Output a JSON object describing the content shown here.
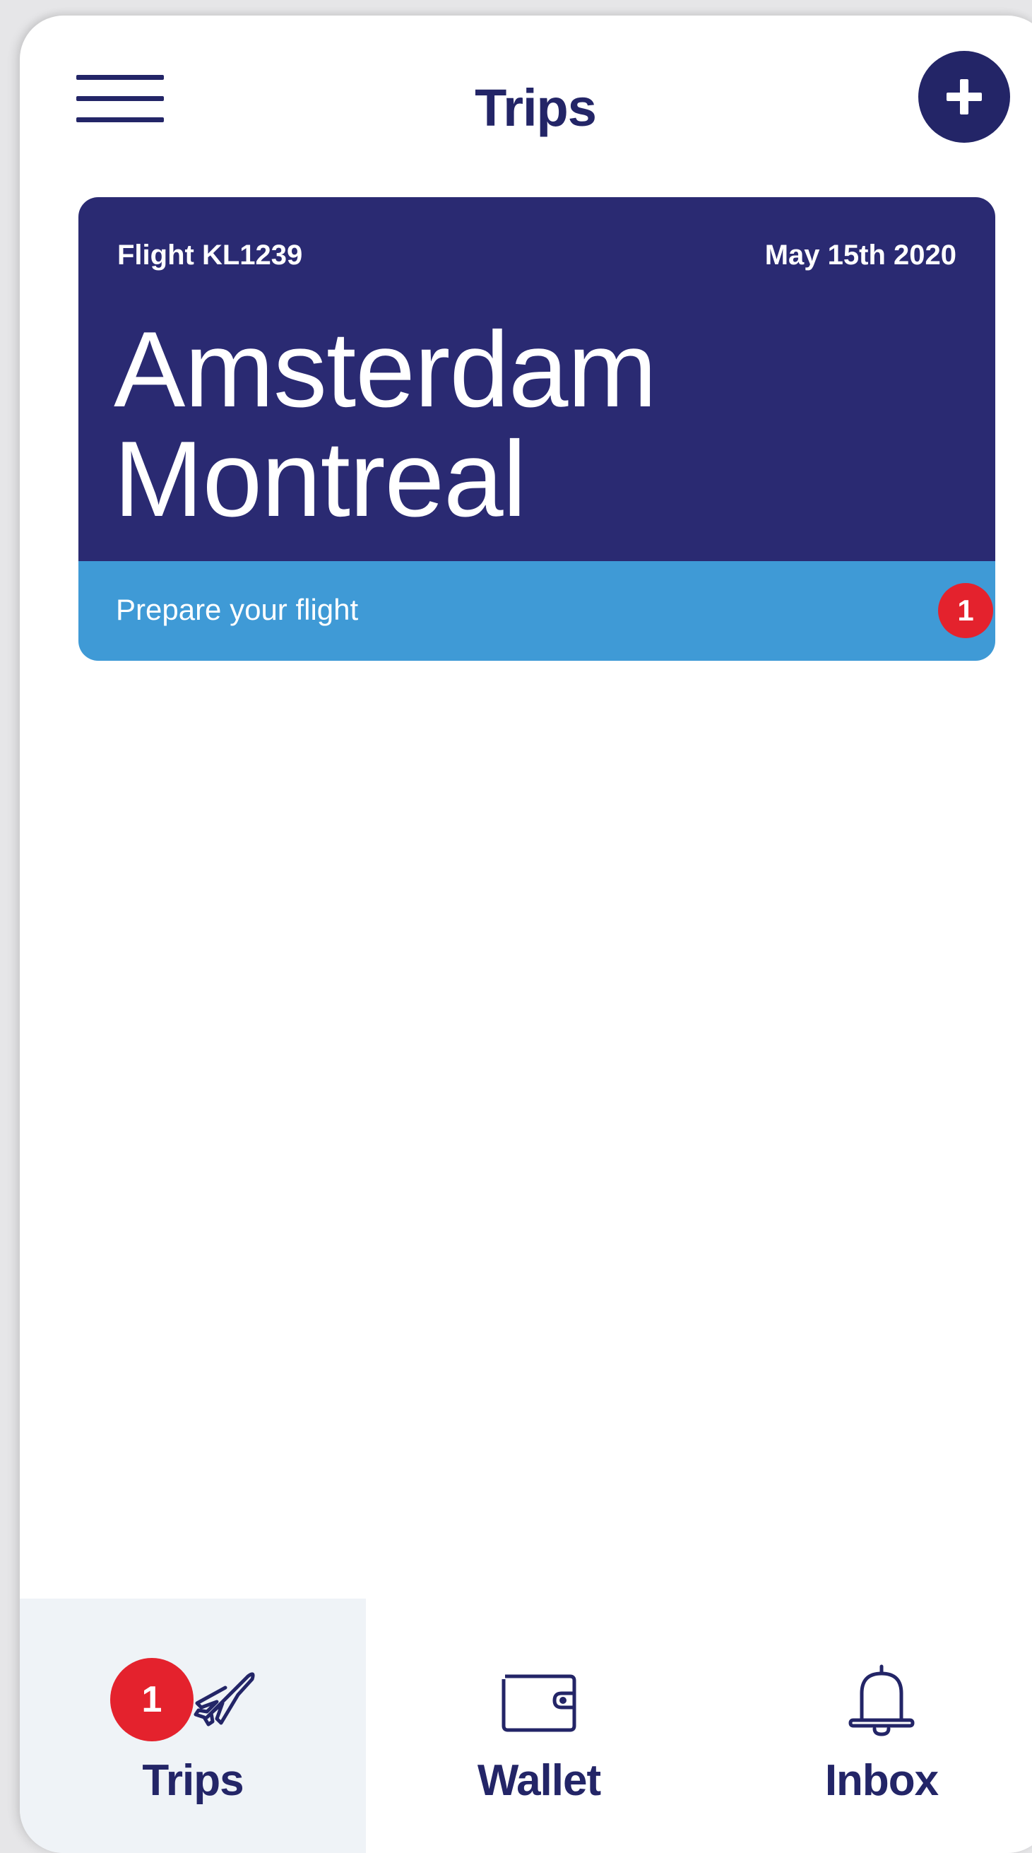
{
  "header": {
    "title": "Trips",
    "menu_icon": "hamburger-menu-icon",
    "add_icon": "plus-icon"
  },
  "trip_card": {
    "flight_number": "Flight KL1239",
    "date": "May 15th 2020",
    "origin": "Amsterdam",
    "destination": "Montreal",
    "action_label": "Prepare your flight",
    "notification_count": "1"
  },
  "bottom_nav": {
    "items": [
      {
        "label": "Trips",
        "icon": "airplane-icon",
        "badge": "1",
        "active": true
      },
      {
        "label": "Wallet",
        "icon": "wallet-icon",
        "active": false
      },
      {
        "label": "Inbox",
        "icon": "bell-icon",
        "active": false
      }
    ]
  },
  "colors": {
    "brand_navy": "#232567",
    "card_navy": "#2a2a72",
    "card_action_blue": "#3f9ad6",
    "badge_red": "#e4222d",
    "active_tab_bg": "#eff3f7"
  }
}
